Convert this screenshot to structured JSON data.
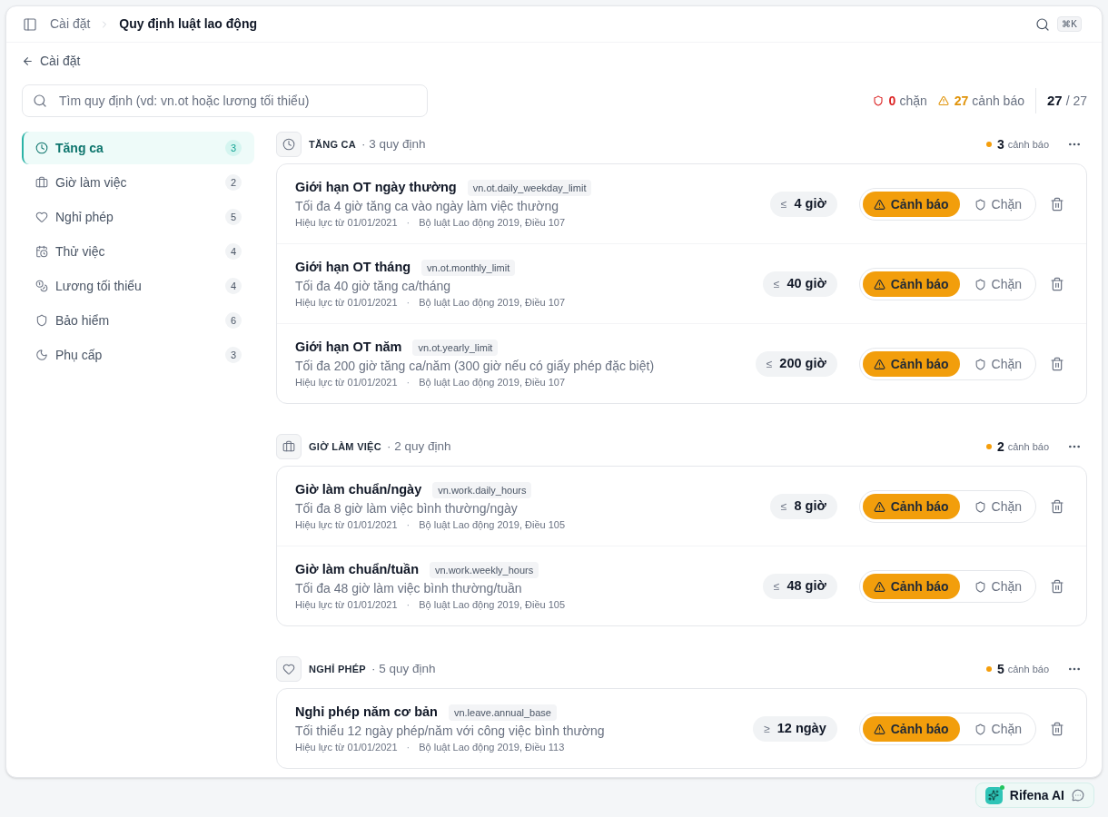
{
  "header": {
    "breadcrumb": [
      {
        "label": "Cài đặt",
        "current": false
      },
      {
        "label": "Quy định luật lao động",
        "current": true
      }
    ],
    "shortcut": "⌘K"
  },
  "back_link": "Cài đặt",
  "search": {
    "placeholder": "Tìm quy định (vd: vn.ot hoặc lương tối thiểu)"
  },
  "summary": {
    "blocked": {
      "count": "0",
      "label": "chặn"
    },
    "warnings": {
      "count": "27",
      "label": "cảnh báo"
    },
    "shown": "27",
    "total": "/ 27"
  },
  "sidebar": {
    "items": [
      {
        "kind": "overtime",
        "label": "Tăng ca",
        "count": "3",
        "selected": true
      },
      {
        "kind": "hours",
        "label": "Giờ làm việc",
        "count": "2",
        "selected": false
      },
      {
        "kind": "leave",
        "label": "Nghỉ phép",
        "count": "5",
        "selected": false
      },
      {
        "kind": "probation",
        "label": "Thử việc",
        "count": "4",
        "selected": false
      },
      {
        "kind": "wage",
        "label": "Lương tối thiểu",
        "count": "4",
        "selected": false
      },
      {
        "kind": "insurance",
        "label": "Bảo hiểm",
        "count": "6",
        "selected": false
      },
      {
        "kind": "allowance",
        "label": "Phụ cấp",
        "count": "3",
        "selected": false
      }
    ]
  },
  "groups": [
    {
      "kind": "overtime",
      "title": "TĂNG CA",
      "count_label": "· 3 quy định",
      "warnings": {
        "count": "3",
        "label": "cảnh báo"
      },
      "rules": [
        {
          "title": "Giới hạn OT ngày thường",
          "code": "vn.ot.daily_weekday_limit",
          "description": "Tối đa 4 giờ tăng ca vào ngày làm việc thường",
          "effective": "Hiệu lực từ 01/01/2021",
          "separator": "·",
          "source": "Bộ luật Lao động 2019, Điều 107",
          "operator": "≤",
          "limit": "4 giờ",
          "modes": [
            {
              "kind": "warn",
              "label": "Cảnh báo",
              "selected": true
            },
            {
              "kind": "block",
              "label": "Chặn",
              "selected": false
            }
          ]
        },
        {
          "title": "Giới hạn OT tháng",
          "code": "vn.ot.monthly_limit",
          "description": "Tối đa 40 giờ tăng ca/tháng",
          "effective": "Hiệu lực từ 01/01/2021",
          "separator": "·",
          "source": "Bộ luật Lao động 2019, Điều 107",
          "operator": "≤",
          "limit": "40 giờ",
          "modes": [
            {
              "kind": "warn",
              "label": "Cảnh báo",
              "selected": true
            },
            {
              "kind": "block",
              "label": "Chặn",
              "selected": false
            }
          ]
        },
        {
          "title": "Giới hạn OT năm",
          "code": "vn.ot.yearly_limit",
          "description": "Tối đa 200 giờ tăng ca/năm (300 giờ nếu có giấy phép đặc biệt)",
          "effective": "Hiệu lực từ 01/01/2021",
          "separator": "·",
          "source": "Bộ luật Lao động 2019, Điều 107",
          "operator": "≤",
          "limit": "200 giờ",
          "modes": [
            {
              "kind": "warn",
              "label": "Cảnh báo",
              "selected": true
            },
            {
              "kind": "block",
              "label": "Chặn",
              "selected": false
            }
          ]
        }
      ]
    },
    {
      "kind": "hours",
      "title": "GIỜ LÀM VIỆC",
      "count_label": "· 2 quy định",
      "warnings": {
        "count": "2",
        "label": "cảnh báo"
      },
      "rules": [
        {
          "title": "Giờ làm chuẩn/ngày",
          "code": "vn.work.daily_hours",
          "description": "Tối đa 8 giờ làm việc bình thường/ngày",
          "effective": "Hiệu lực từ 01/01/2021",
          "separator": "·",
          "source": "Bộ luật Lao động 2019, Điều 105",
          "operator": "≤",
          "limit": "8 giờ",
          "modes": [
            {
              "kind": "warn",
              "label": "Cảnh báo",
              "selected": true
            },
            {
              "kind": "block",
              "label": "Chặn",
              "selected": false
            }
          ]
        },
        {
          "title": "Giờ làm chuẩn/tuần",
          "code": "vn.work.weekly_hours",
          "description": "Tối đa 48 giờ làm việc bình thường/tuần",
          "effective": "Hiệu lực từ 01/01/2021",
          "separator": "·",
          "source": "Bộ luật Lao động 2019, Điều 105",
          "operator": "≤",
          "limit": "48 giờ",
          "modes": [
            {
              "kind": "warn",
              "label": "Cảnh báo",
              "selected": true
            },
            {
              "kind": "block",
              "label": "Chặn",
              "selected": false
            }
          ]
        }
      ]
    },
    {
      "kind": "leave",
      "title": "NGHỈ PHÉP",
      "count_label": "· 5 quy định",
      "warnings": {
        "count": "5",
        "label": "cảnh báo"
      },
      "rules": [
        {
          "title": "Nghỉ phép năm cơ bản",
          "code": "vn.leave.annual_base",
          "description": "Tối thiểu 12 ngày phép/năm với công việc bình thường",
          "effective": "Hiệu lực từ 01/01/2021",
          "separator": "·",
          "source": "Bộ luật Lao động 2019, Điều 113",
          "operator": "≥",
          "limit": "12 ngày",
          "modes": [
            {
              "kind": "warn",
              "label": "Cảnh báo",
              "selected": true
            },
            {
              "kind": "block",
              "label": "Chặn",
              "selected": false
            }
          ]
        }
      ]
    }
  ],
  "assistant": {
    "label": "Rifena AI"
  }
}
